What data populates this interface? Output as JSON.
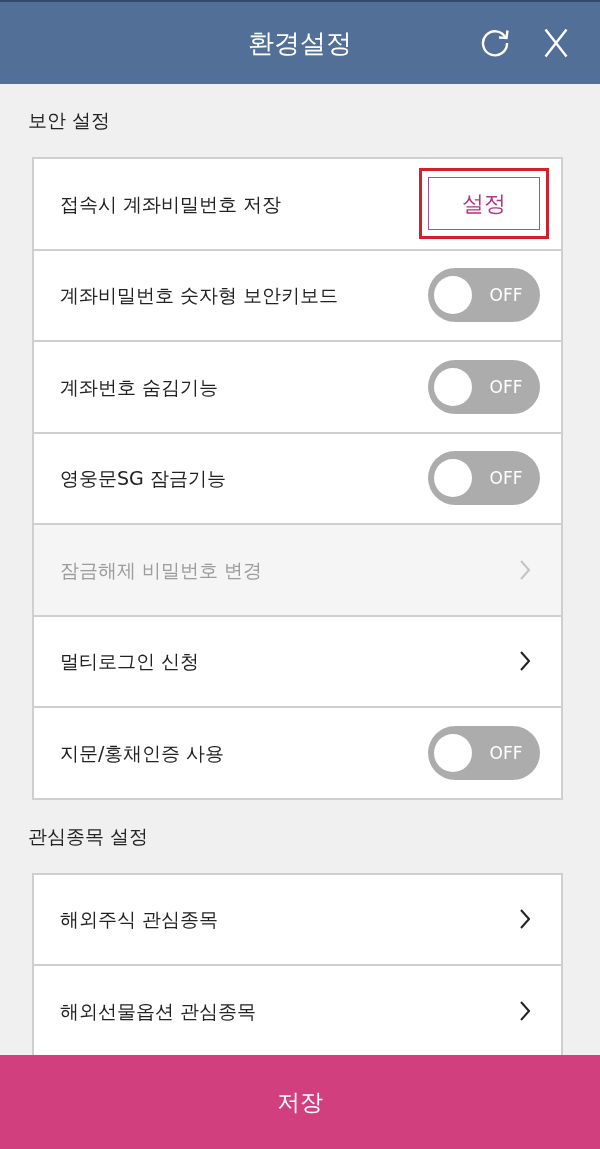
{
  "header": {
    "title": "환경설정"
  },
  "sections": [
    {
      "title": "보안 설정",
      "items": [
        {
          "kind": "button",
          "label": "접속시 계좌비밀번호 저장",
          "button": "설정",
          "highlighted": true,
          "disabled": false
        },
        {
          "kind": "toggle",
          "label": "계좌비밀번호 숫자형 보안키보드",
          "on": false,
          "state_text": "OFF",
          "disabled": false
        },
        {
          "kind": "toggle",
          "label": "계좌번호 숨김기능",
          "on": false,
          "state_text": "OFF",
          "disabled": false
        },
        {
          "kind": "toggle",
          "label": "영웅문SG 잠금기능",
          "on": false,
          "state_text": "OFF",
          "disabled": false
        },
        {
          "kind": "link",
          "label": "잠금해제 비밀번호 변경",
          "disabled": true
        },
        {
          "kind": "link",
          "label": "멀티로그인 신청",
          "disabled": false
        },
        {
          "kind": "toggle",
          "label": "지문/홍채인증 사용",
          "on": false,
          "state_text": "OFF",
          "disabled": false
        }
      ]
    },
    {
      "title": "관심종목 설정",
      "items": [
        {
          "kind": "link",
          "label": "해외주식 관심종목",
          "disabled": false
        },
        {
          "kind": "link",
          "label": "해외선물옵션 관심종목",
          "disabled": false
        }
      ]
    }
  ],
  "footer": {
    "button": "저장"
  }
}
